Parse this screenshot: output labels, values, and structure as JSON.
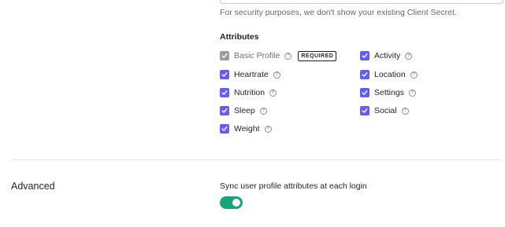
{
  "secret": {
    "hint": "For security purposes, we don't show your existing Client Secret."
  },
  "attributes": {
    "title": "Attributes",
    "left": [
      {
        "label": "Basic Profile",
        "checked": true,
        "disabled": true,
        "badge": "REQUIRED"
      },
      {
        "label": "Heartrate",
        "checked": true
      },
      {
        "label": "Nutrition",
        "checked": true
      },
      {
        "label": "Sleep",
        "checked": true
      },
      {
        "label": "Weight",
        "checked": true
      }
    ],
    "right": [
      {
        "label": "Activity",
        "checked": true
      },
      {
        "label": "Location",
        "checked": true
      },
      {
        "label": "Settings",
        "checked": true
      },
      {
        "label": "Social",
        "checked": true
      }
    ],
    "help_glyph": "?"
  },
  "advanced": {
    "title": "Advanced",
    "sync_label": "Sync user profile attributes at each login",
    "sync_enabled": true
  },
  "colors": {
    "checkbox": "#635dff",
    "checkbox_disabled": "#9b9ca3",
    "toggle_on": "#17a37c"
  },
  "icons": {
    "checkbox": "checkmark-icon",
    "help": "question-circle-icon"
  }
}
